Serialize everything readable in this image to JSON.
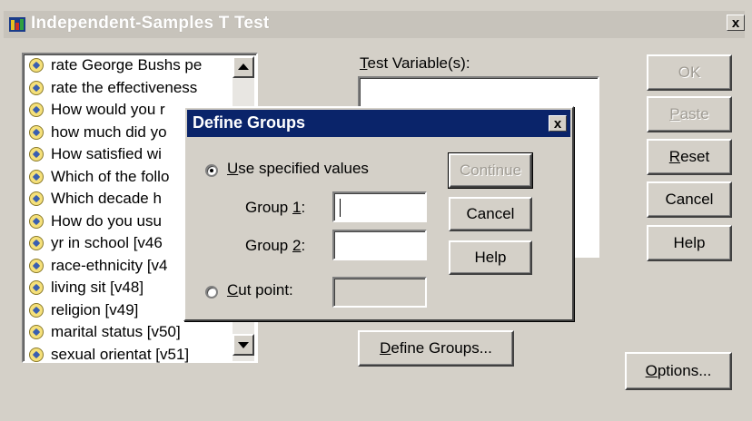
{
  "window": {
    "title": "Independent-Samples T Test",
    "close_label": "x"
  },
  "variables": [
    "rate George Bushs pe",
    "rate the effectiveness",
    "How would you r",
    "how much did yo",
    "How satisfied wi",
    "Which of the follo",
    "Which decade h",
    "How do you usu",
    "yr in school [v46",
    "race-ethnicity [v4",
    "living sit [v48]",
    "religion [v49]",
    "marital status [v50]",
    "sexual orientat [v51]"
  ],
  "test_variables": {
    "label_prefix": "",
    "label_mnemonic": "T",
    "label_rest": "est Variable(s):"
  },
  "buttons": {
    "ok": "OK",
    "paste_mnemonic": "P",
    "paste_rest": "aste",
    "reset_mnemonic": "R",
    "reset_rest": "eset",
    "cancel": "Cancel",
    "help": "Help",
    "options_mnemonic": "O",
    "options_rest": "ptions...",
    "define_groups_mnemonic": "D",
    "define_groups_rest": "efine Groups..."
  },
  "define_groups": {
    "title": "Define Groups",
    "close_label": "x",
    "use_specified_mnemonic": "U",
    "use_specified_rest": "se specified values",
    "group1_prefix": "Group ",
    "group1_mnemonic": "1",
    "group1_suffix": ":",
    "group1_value": "",
    "group2_prefix": "Group ",
    "group2_mnemonic": "2",
    "group2_suffix": ":",
    "group2_value": "",
    "cut_point_mnemonic": "C",
    "cut_point_rest": "ut point:",
    "cut_point_value": "",
    "continue": "Continue",
    "cancel": "Cancel",
    "help": "Help",
    "selected_option": "Use specified values"
  }
}
